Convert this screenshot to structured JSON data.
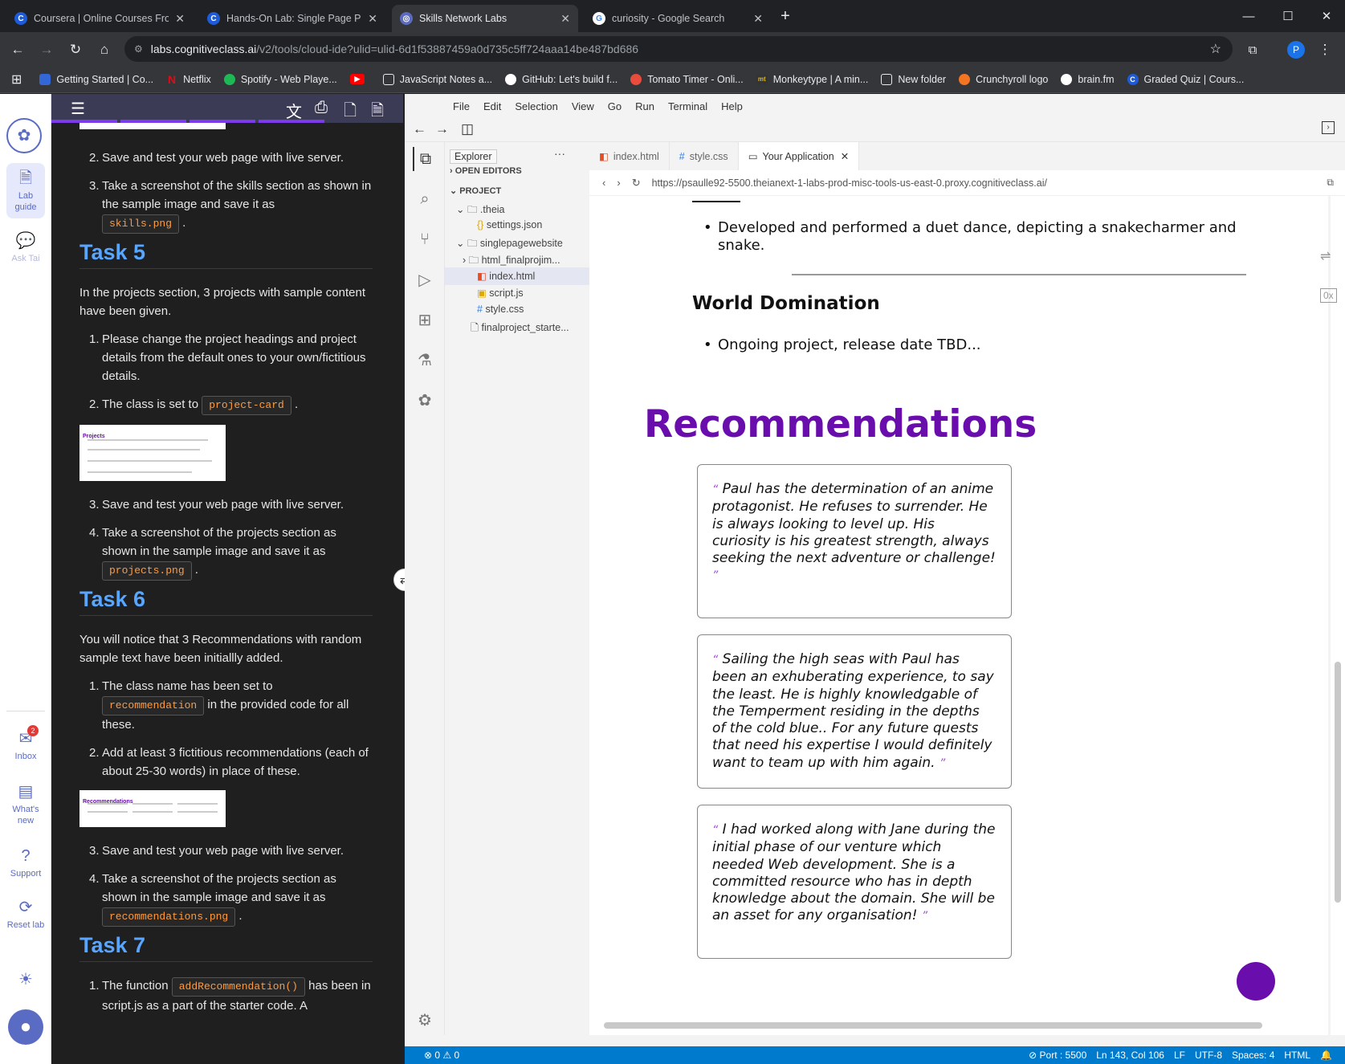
{
  "browser": {
    "tabs": [
      {
        "title": "Coursera | Online Courses From",
        "favicon": "C",
        "color": "#1f5bd6"
      },
      {
        "title": "Hands-On Lab: Single Page Port",
        "favicon": "C",
        "color": "#1f5bd6"
      },
      {
        "title": "Skills Network Labs",
        "favicon": "",
        "color": "#5c6bc0"
      },
      {
        "title": "curiosity - Google Search",
        "favicon": "G",
        "color": "#ffffff"
      }
    ],
    "new_tab": "+",
    "url_host": "labs.cognitiveclass.ai",
    "url_path": "/v2/tools/cloud-ide?ulid=ulid-6d1f53887459a0d735c5ff724aaa14be487bd686",
    "profile_initial": "P",
    "bookmarks": [
      {
        "label": "Getting Started | Co...",
        "color": "#3367d6"
      },
      {
        "label": "Netflix",
        "color": "#e50914",
        "glyph": "N"
      },
      {
        "label": "Spotify - Web Playe...",
        "color": "#1db954"
      },
      {
        "label": "",
        "color": "#ff0000"
      },
      {
        "label": "JavaScript Notes a...",
        "color": "#35363a"
      },
      {
        "label": "GitHub: Let's build f...",
        "color": "#ffffff"
      },
      {
        "label": "Tomato Timer - Onli...",
        "color": "#e74c3c"
      },
      {
        "label": "Monkeytype | A min...",
        "color": "#e2b714",
        "glyph": "mt"
      },
      {
        "label": "New folder",
        "color": "#35363a"
      },
      {
        "label": "Crunchyroll logo",
        "color": "#f47521"
      },
      {
        "label": "brain.fm",
        "color": "#ffffff"
      },
      {
        "label": "Graded Quiz | Cours...",
        "color": "#1f5bd6",
        "glyph": "C"
      }
    ]
  },
  "rail": {
    "lab_guide": "Lab guide",
    "ask_tai": "Ask Tai",
    "inbox": "Inbox",
    "inbox_count": "2",
    "whats_new": "What's new",
    "support": "Support",
    "reset_lab": "Reset lab"
  },
  "guide": {
    "t4_item2": "Save and test your web page with live server.",
    "t4_item3": "Take a screenshot of the skills section as shown in the sample image and save it as",
    "t4_code": "skills.png",
    "task5": "Task 5",
    "t5_intro": "In the projects section, 3 projects with sample content have been given.",
    "t5_item1": "Please change the project headings and project details from the default ones to your own/fictitious details.",
    "t5_item2": "The class is set to",
    "t5_code1": "project-card",
    "t5_thumb_title": "Projects",
    "t5_item3": "Save and test your web page with live server.",
    "t5_item4": "Take a screenshot of the projects section as shown in the sample image and save it as",
    "t5_code2": "projects.png",
    "task6": "Task 6",
    "t6_intro": "You will notice that 3 Recommendations with random sample text have been initiallly added.",
    "t6_item1a": "The class name has been set to",
    "t6_code1": "recommendation",
    "t6_item1b": "in the provided code for all these.",
    "t6_item2": "Add at least 3 fictitious recommendations (each of about 25-30 words) in place of these.",
    "t6_thumb_title": "Recommendations",
    "t6_item3": "Save and test your web page with live server.",
    "t6_item4": "Take a screenshot of the projects section as shown in the sample image and save it as",
    "t6_code2": "recommendations.png",
    "task7": "Task 7",
    "t7_item1a": "The function",
    "t7_code1": "addRecommendation()",
    "t7_item1b": "has been in script.js as a part of the starter code. A"
  },
  "ide": {
    "menu": [
      "File",
      "Edit",
      "Selection",
      "View",
      "Go",
      "Run",
      "Terminal",
      "Help"
    ],
    "explorer_tooltip": "Explorer",
    "open_editors": "OPEN EDITORS",
    "project": "PROJECT",
    "tree": [
      ".theia",
      "settings.json",
      "singlepagewebsite",
      "html_finalprojim...",
      "index.html",
      "script.js",
      "style.css",
      "finalproject_starte..."
    ],
    "tabs": [
      "index.html",
      "style.css",
      "Your Application"
    ],
    "preview_url": "https://psaulle92-5500.theianext-1-labs-prod-misc-tools-us-east-0.proxy.cognitiveclass.ai/",
    "status": {
      "problems": "0",
      "warnings": "0",
      "port": "Port : 5500",
      "position": "Ln 143, Col 106",
      "eol": "LF",
      "encoding": "UTF-8",
      "spaces": "Spaces: 4",
      "lang": "HTML"
    }
  },
  "preview": {
    "dance_item": "Developed and performed a duet dance, depicting a snakecharmer and snake.",
    "world_heading": "World Domination",
    "world_item": "Ongoing project, release date TBD...",
    "recommendations_heading": "Recommendations",
    "rec1": "Paul has the determination of an anime protagonist. He refuses to surrender. He is always looking to level up. His curiosity is his greatest strength, always seeking the next adventure or challenge!",
    "rec2": "Sailing the high seas with Paul has been an exhuberating experience, to say the least. He is highly knowledgable of the Temperment residing in the depths of the cold blue.. For any future quests that need his expertise I would definitely want to team up with him again.",
    "rec3": "I had worked along with Jane during the initial phase of our venture which needed Web development. She is a committed resource who has in depth knowledge about the domain. She will be an asset for any organisation!",
    "accent": "#6a0dad"
  }
}
